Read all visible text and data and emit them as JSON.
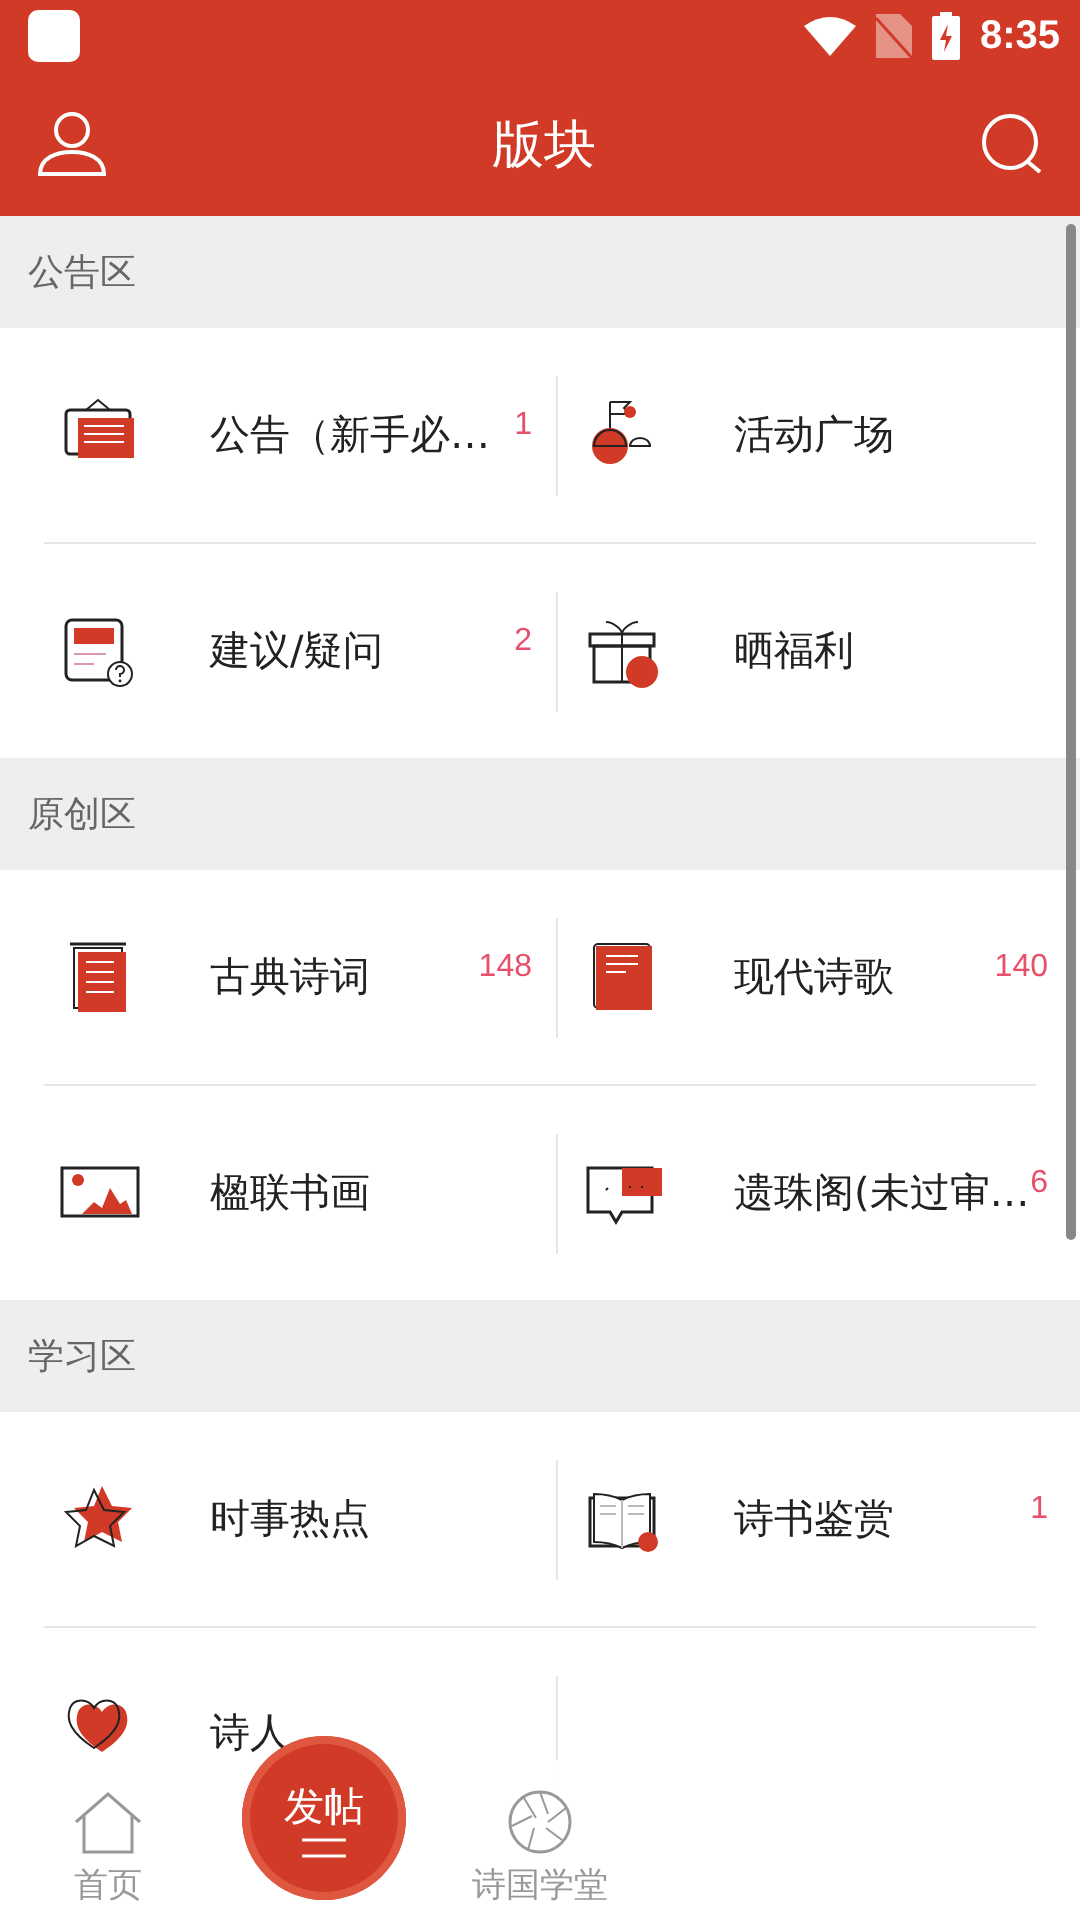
{
  "status_bar": {
    "time": "8:35"
  },
  "header": {
    "title": "版块"
  },
  "sections": [
    {
      "title": "公告区",
      "items": [
        {
          "label": "公告（新手必…",
          "badge": "1"
        },
        {
          "label": "活动广场"
        },
        {
          "label": "建议/疑问",
          "badge": "2"
        },
        {
          "label": "晒福利"
        }
      ]
    },
    {
      "title": "原创区",
      "items": [
        {
          "label": "古典诗词",
          "badge": "148"
        },
        {
          "label": "现代诗歌",
          "badge": "140"
        },
        {
          "label": "楹联书画"
        },
        {
          "label": "遗珠阁(未过审…",
          "badge": "6"
        }
      ]
    },
    {
      "title": "学习区",
      "items": [
        {
          "label": "时事热点"
        },
        {
          "label": "诗书鉴赏",
          "badge": "1"
        },
        {
          "label": "诗人"
        }
      ]
    }
  ],
  "bottom_nav": {
    "tabs": [
      {
        "label": "首页",
        "selected": false
      },
      {
        "label": "诗国学堂",
        "selected": false
      }
    ],
    "post_button": {
      "label": "发帖"
    }
  }
}
